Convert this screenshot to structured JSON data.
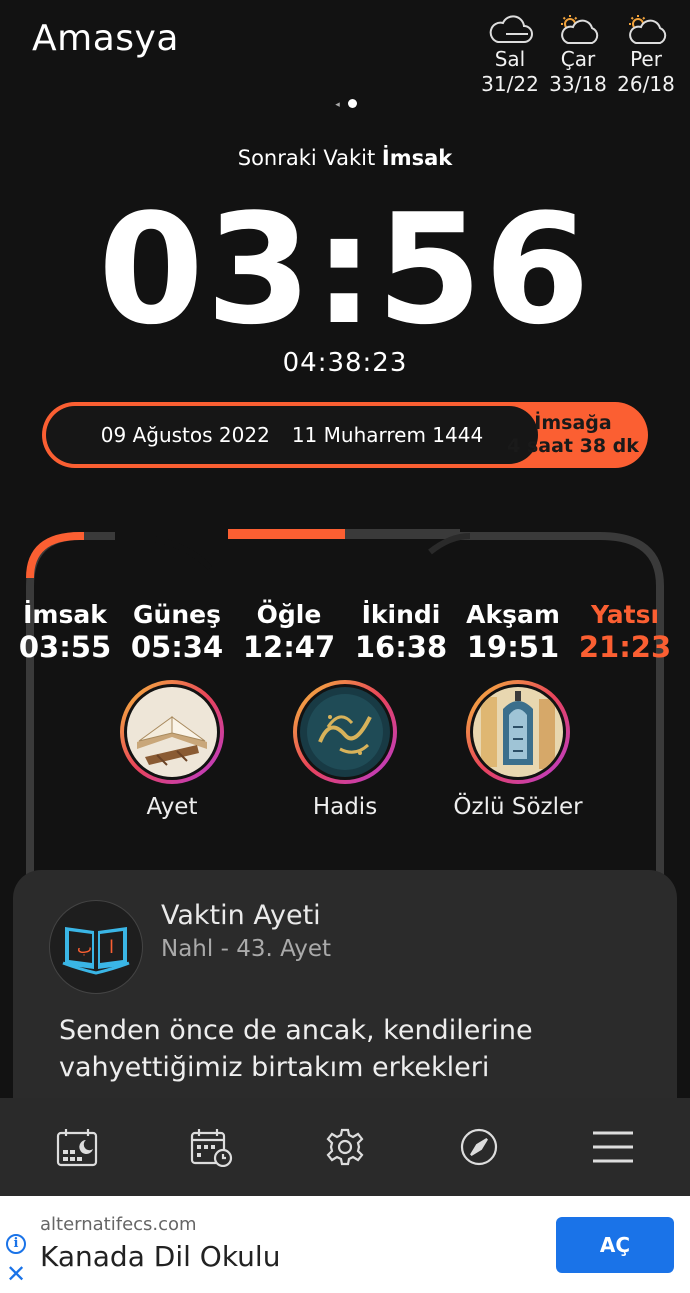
{
  "header": {
    "city": "Amasya"
  },
  "weather": [
    {
      "day": "Sal",
      "temps": "31/22",
      "icon": "cloud-icon"
    },
    {
      "day": "Çar",
      "temps": "33/18",
      "icon": "sun-cloud-icon"
    },
    {
      "day": "Per",
      "temps": "26/18",
      "icon": "sun-cloud-icon"
    }
  ],
  "next_prayer": {
    "label": "Sonraki Vakit",
    "name": "İmsak",
    "time": "03:56",
    "countdown": "04:38:23"
  },
  "date_bar": {
    "gregorian": "09 Ağustos 2022",
    "hijri": "11 Muharrem 1444",
    "remaining_label": "İmsağa",
    "remaining_value": "4 saat 38 dk"
  },
  "prayer_times": [
    {
      "name": "İmsak",
      "time": "03:55"
    },
    {
      "name": "Güneş",
      "time": "05:34"
    },
    {
      "name": "Öğle",
      "time": "12:47"
    },
    {
      "name": "İkindi",
      "time": "16:38"
    },
    {
      "name": "Akşam",
      "time": "19:51"
    },
    {
      "name": "Yatsı",
      "time": "21:23"
    }
  ],
  "active_prayer": "Yatsı",
  "stories": [
    {
      "label": "Ayet"
    },
    {
      "label": "Hadis"
    },
    {
      "label": "Özlü Sözler"
    }
  ],
  "verse_card": {
    "title": "Vaktin Ayeti",
    "subtitle": "Nahl - 43. Ayet",
    "text": "Senden önce de ancak, kendilerine vahyettiğimiz birtakım erkekleri"
  },
  "bottom_nav": [
    "calendar-moon-icon",
    "calendar-clock-icon",
    "gear-icon",
    "compass-icon",
    "menu-icon"
  ],
  "ad": {
    "url": "alternatifecs.com",
    "title": "Kanada Dil Okulu",
    "button": "AÇ",
    "info": "i",
    "close": "✕"
  },
  "colors": {
    "accent": "#fb5f32",
    "background": "#121212",
    "card": "#2b2b2b",
    "ad_button": "#1a73e8"
  }
}
